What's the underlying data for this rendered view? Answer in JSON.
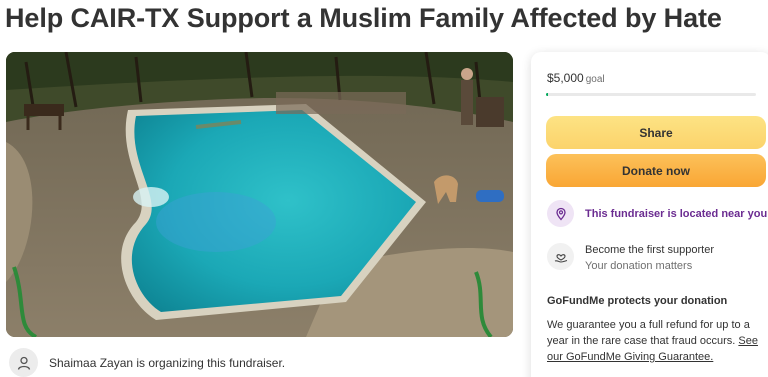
{
  "campaign": {
    "title": "Help CAIR-TX Support a Muslim Family Affected by Hate"
  },
  "organizer": {
    "text": "Shaimaa Zayan is organizing this fundraiser."
  },
  "donation_card": {
    "goal_amount": "$5,000",
    "goal_word": "goal",
    "progress_fraction": 0.01,
    "share_label": "Share",
    "donate_label": "Donate now",
    "location_text": "This fundraiser is located near you",
    "first_supporter_title": "Become the first supporter",
    "first_supporter_subtitle": "Your donation matters",
    "protection_title": "GoFundMe protects your donation",
    "protection_body": "We guarantee you a full refund for up to a year in the rare case that fraud occurs.",
    "protection_link": "See our GoFundMe Giving Guarantee."
  },
  "colors": {
    "share_button": "#fbd36b",
    "donate_button": "#f9a634",
    "progress_fill": "#02a95c",
    "location_text": "#6b2c91",
    "location_icon_bg": "#efe4f5"
  },
  "icons": {
    "organizer": "user-avatar-icon",
    "location": "location-pin-icon",
    "supporter": "heart-hand-icon"
  }
}
